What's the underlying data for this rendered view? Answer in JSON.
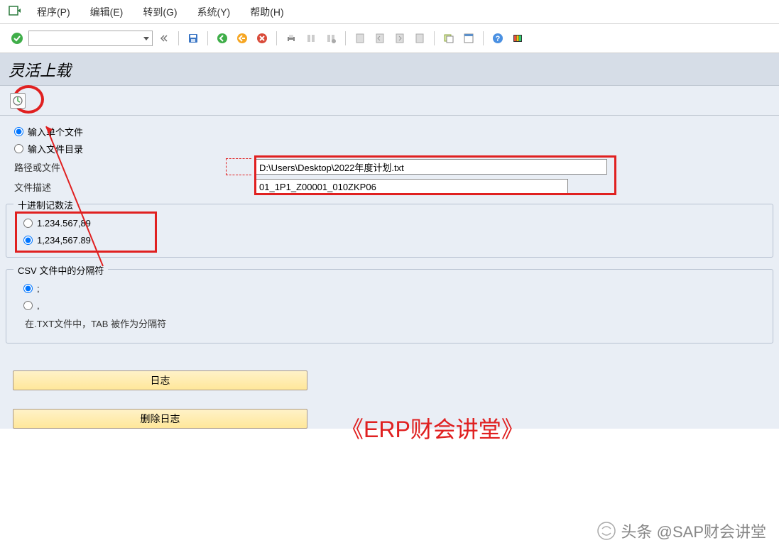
{
  "menu": {
    "items": [
      "程序(P)",
      "编辑(E)",
      "转到(G)",
      "系统(Y)",
      "帮助(H)"
    ]
  },
  "title": "灵活上载",
  "fileGroup": {
    "radioSingle": "输入单个文件",
    "radioDirectory": "输入文件目录",
    "pathLabel": "路径或文件",
    "pathValue": "D:\\Users\\Desktop\\2022年度计划.txt",
    "descLabel": "文件描述",
    "descValue": "01_1P1_Z00001_010ZKP06"
  },
  "decimalGroup": {
    "title": "十进制记数法",
    "opt1": "1.234.567,89",
    "opt2": "1,234,567.89"
  },
  "csvGroup": {
    "title": "CSV 文件中的分隔符",
    "opt1": ";",
    "opt2": ",",
    "info": "在.TXT文件中，TAB 被作为分隔符"
  },
  "buttons": {
    "log": "日志",
    "deleteLog": "删除日志"
  },
  "brand": "《ERP财会讲堂》",
  "watermark": "头条 @SAP财会讲堂"
}
